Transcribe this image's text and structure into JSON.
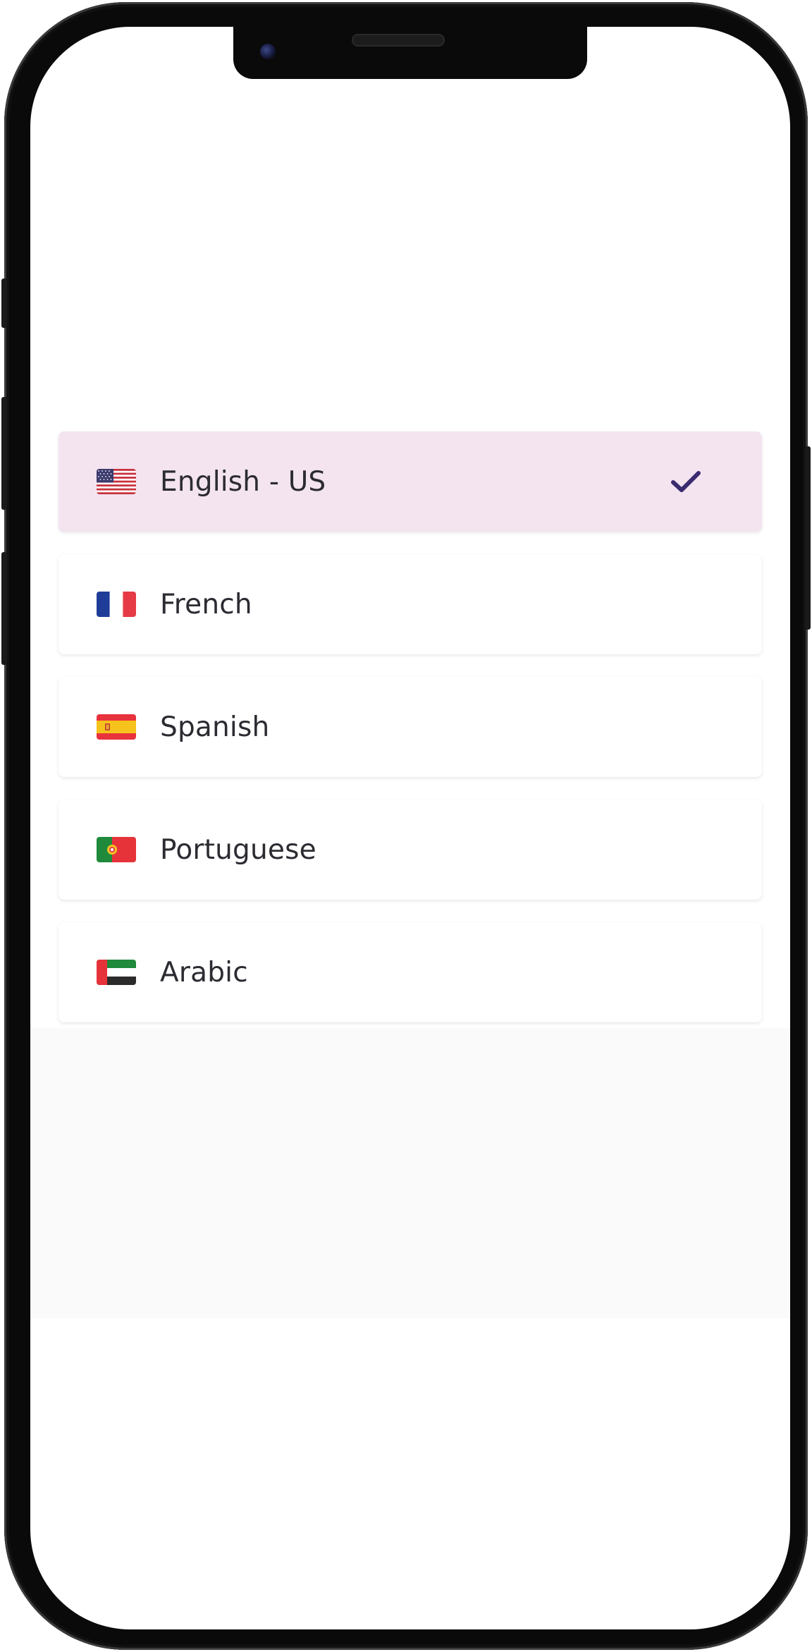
{
  "languages": [
    {
      "label": "English - US",
      "flag_icon": "us-flag-icon",
      "selected": true
    },
    {
      "label": "French",
      "flag_icon": "france-flag-icon",
      "selected": false
    },
    {
      "label": "Spanish",
      "flag_icon": "spain-flag-icon",
      "selected": false
    },
    {
      "label": "Portuguese",
      "flag_icon": "portugal-flag-icon",
      "selected": false
    },
    {
      "label": "Arabic",
      "flag_icon": "uae-flag-icon",
      "selected": false
    }
  ],
  "selected_icon": "checkmark-icon",
  "colors": {
    "selected_row_bg": "#f3e4f0",
    "checkmark": "#3a2a6e",
    "text": "#2c2b32",
    "phone_frame": "#0a0a0a"
  }
}
